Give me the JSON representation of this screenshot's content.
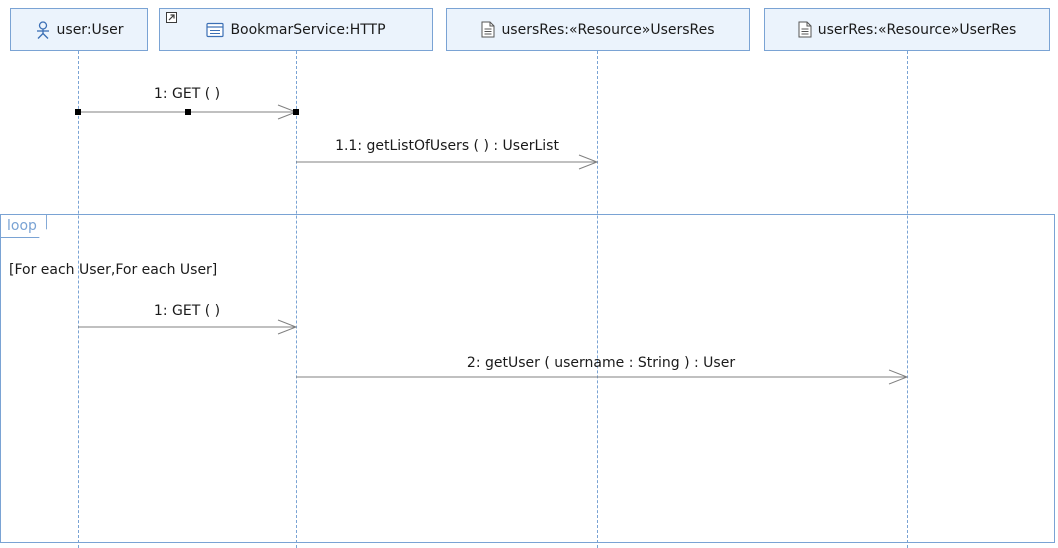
{
  "lifelines": [
    {
      "label": "user:User",
      "icon": "actor-icon"
    },
    {
      "label": "BookmarService:HTTP",
      "icon": "service-icon"
    },
    {
      "label": "usersRes:«Resource»UsersRes",
      "icon": "document-icon"
    },
    {
      "label": "userRes:«Resource»UserRes",
      "icon": "document-icon"
    }
  ],
  "messages": [
    {
      "label": "1: GET ( )"
    },
    {
      "label": "1.1: getListOfUsers ( ) : UserList"
    },
    {
      "label": "1: GET ( )"
    },
    {
      "label": "2: getUser ( username : String ) : User"
    }
  ],
  "loop": {
    "tag": "loop",
    "guard": "[For each User,For each User]"
  },
  "colors": {
    "lifeline_border": "#7aa3d4",
    "lifeline_fill": "#ebf3fc",
    "message_line": "#808080"
  }
}
